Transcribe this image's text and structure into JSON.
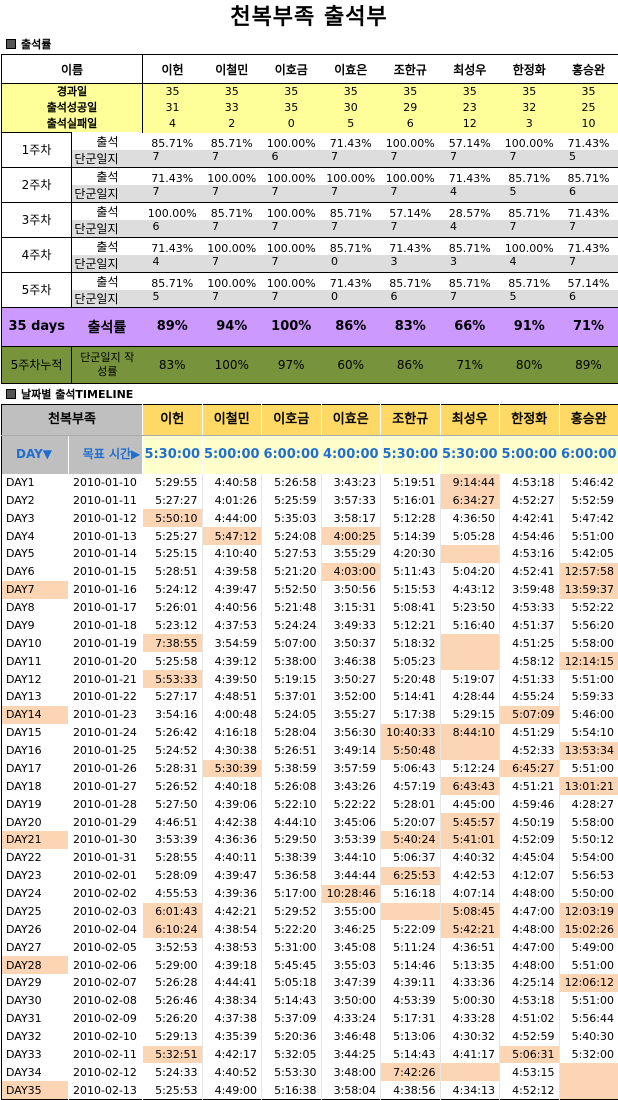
{
  "title": "천복부족 출석부",
  "section1_title": "출석률",
  "section2_title": "날짜별 출석TIMELINE",
  "members": [
    "이헌",
    "이철민",
    "이호금",
    "이효은",
    "조한규",
    "최성우",
    "한정화",
    "홍승완"
  ],
  "summary": {
    "name_label": "이름",
    "rows": [
      {
        "label": "경과일",
        "values": [
          "35",
          "35",
          "35",
          "35",
          "35",
          "35",
          "35",
          "35"
        ]
      },
      {
        "label": "출석성공일",
        "values": [
          "31",
          "33",
          "35",
          "30",
          "29",
          "23",
          "32",
          "25"
        ]
      },
      {
        "label": "출석실패일",
        "values": [
          "4",
          "2",
          "0",
          "5",
          "6",
          "12",
          "3",
          "10"
        ]
      }
    ]
  },
  "weeks": [
    {
      "label": "1주차",
      "att_label": "출석",
      "log_label": "단군일지",
      "att": [
        "85.71%",
        "85.71%",
        "100.00%",
        "71.43%",
        "100.00%",
        "57.14%",
        "100.00%",
        "71.43%"
      ],
      "log": [
        "7",
        "7",
        "6",
        "7",
        "7",
        "7",
        "7",
        "5"
      ]
    },
    {
      "label": "2주차",
      "att_label": "출석",
      "log_label": "단군일지",
      "att": [
        "71.43%",
        "100.00%",
        "100.00%",
        "100.00%",
        "100.00%",
        "71.43%",
        "85.71%",
        "85.71%"
      ],
      "log": [
        "7",
        "7",
        "7",
        "7",
        "7",
        "4",
        "5",
        "6"
      ]
    },
    {
      "label": "3주차",
      "att_label": "출석",
      "log_label": "단군일지",
      "att": [
        "100.00%",
        "85.71%",
        "100.00%",
        "85.71%",
        "57.14%",
        "28.57%",
        "85.71%",
        "71.43%"
      ],
      "log": [
        "6",
        "7",
        "7",
        "7",
        "7",
        "4",
        "7",
        "7"
      ]
    },
    {
      "label": "4주차",
      "att_label": "출석",
      "log_label": "단군일지",
      "att": [
        "71.43%",
        "100.00%",
        "100.00%",
        "85.71%",
        "71.43%",
        "85.71%",
        "100.00%",
        "71.43%"
      ],
      "log": [
        "4",
        "7",
        "7",
        "0",
        "3",
        "3",
        "4",
        "7"
      ]
    },
    {
      "label": "5주차",
      "att_label": "출석",
      "log_label": "단군일지",
      "att": [
        "85.71%",
        "100.00%",
        "100.00%",
        "71.43%",
        "85.71%",
        "85.71%",
        "85.71%",
        "57.14%"
      ],
      "log": [
        "5",
        "7",
        "7",
        "0",
        "6",
        "7",
        "5",
        "6"
      ]
    }
  ],
  "total": {
    "label": "35 days",
    "metric": "출석률",
    "values": [
      "89%",
      "94%",
      "100%",
      "86%",
      "83%",
      "66%",
      "91%",
      "71%"
    ]
  },
  "cumulative": {
    "label": "5주차누적",
    "metric": "단군일지 작성률",
    "values": [
      "83%",
      "100%",
      "97%",
      "60%",
      "86%",
      "71%",
      "80%",
      "89%"
    ]
  },
  "timeline": {
    "group_label": "천복부족",
    "day_header": "DAY▼",
    "target_header": "목표 시간▶",
    "targets": [
      "5:30:00",
      "5:00:00",
      "6:00:00",
      "4:00:00",
      "5:30:00",
      "5:30:00",
      "5:00:00",
      "6:00:00"
    ],
    "rows": [
      {
        "day": "DAY1",
        "date": "2010-01-10",
        "times": [
          "5:29:55",
          "4:40:58",
          "5:26:58",
          "3:43:23",
          "5:19:51",
          "9:14:44",
          "4:53:18",
          "5:46:42"
        ],
        "hl": [
          5
        ]
      },
      {
        "day": "DAY2",
        "date": "2010-01-11",
        "times": [
          "5:27:27",
          "4:01:26",
          "5:25:59",
          "3:57:33",
          "5:16:01",
          "6:34:27",
          "4:52:27",
          "5:52:59"
        ],
        "hl": [
          5
        ]
      },
      {
        "day": "DAY3",
        "date": "2010-01-12",
        "times": [
          "5:50:10",
          "4:44:00",
          "5:35:03",
          "3:58:17",
          "5:12:28",
          "4:36:50",
          "4:42:41",
          "5:47:42"
        ],
        "hl": [
          0
        ]
      },
      {
        "day": "DAY4",
        "date": "2010-01-13",
        "times": [
          "5:25:27",
          "5:47:12",
          "5:24:08",
          "4:00:25",
          "5:14:39",
          "5:05:28",
          "4:54:46",
          "5:51:00"
        ],
        "hl": [
          1,
          3
        ]
      },
      {
        "day": "DAY5",
        "date": "2010-01-14",
        "times": [
          "5:25:15",
          "4:10:40",
          "5:27:53",
          "3:55:29",
          "4:20:30",
          "",
          "4:53:16",
          "5:42:05"
        ],
        "hl": [
          5
        ]
      },
      {
        "day": "DAY6",
        "date": "2010-01-15",
        "times": [
          "5:28:51",
          "4:39:58",
          "5:21:20",
          "4:03:00",
          "5:11:43",
          "5:04:20",
          "4:52:41",
          "12:57:58"
        ],
        "hl": [
          3,
          7
        ]
      },
      {
        "day": "DAY7",
        "date": "2010-01-16",
        "times": [
          "5:24:12",
          "4:39:47",
          "5:52:50",
          "3:50:56",
          "5:15:53",
          "4:43:12",
          "3:59:48",
          "13:59:37"
        ],
        "hl": [
          7
        ],
        "dayhl": true
      },
      {
        "day": "DAY8",
        "date": "2010-01-17",
        "times": [
          "5:26:01",
          "4:40:56",
          "5:21:48",
          "3:15:31",
          "5:08:41",
          "5:23:50",
          "4:53:33",
          "5:52:22"
        ],
        "hl": []
      },
      {
        "day": "DAY9",
        "date": "2010-01-18",
        "times": [
          "5:23:12",
          "4:37:53",
          "5:24:24",
          "3:49:33",
          "5:12:21",
          "5:16:40",
          "4:51:37",
          "5:56:20"
        ],
        "hl": []
      },
      {
        "day": "DAY10",
        "date": "2010-01-19",
        "times": [
          "7:38:55",
          "3:54:59",
          "5:07:00",
          "3:50:37",
          "5:18:32",
          "",
          "4:51:25",
          "5:58:00"
        ],
        "hl": [
          0,
          5
        ]
      },
      {
        "day": "DAY11",
        "date": "2010-01-20",
        "times": [
          "5:25:58",
          "4:39:12",
          "5:38:00",
          "3:46:38",
          "5:05:23",
          "",
          "4:58:12",
          "12:14:15"
        ],
        "hl": [
          5,
          7
        ]
      },
      {
        "day": "DAY12",
        "date": "2010-01-21",
        "times": [
          "5:53:33",
          "4:39:50",
          "5:19:15",
          "3:50:27",
          "5:20:48",
          "5:19:07",
          "4:51:33",
          "5:51:00"
        ],
        "hl": [
          0
        ]
      },
      {
        "day": "DAY13",
        "date": "2010-01-22",
        "times": [
          "5:27:17",
          "4:48:51",
          "5:37:01",
          "3:52:00",
          "5:14:41",
          "4:28:44",
          "4:55:24",
          "5:59:33"
        ],
        "hl": []
      },
      {
        "day": "DAY14",
        "date": "2010-01-23",
        "times": [
          "3:54:16",
          "4:00:48",
          "5:24:05",
          "3:55:27",
          "5:17:38",
          "5:29:15",
          "5:07:09",
          "5:46:00"
        ],
        "hl": [
          6
        ],
        "dayhl": true
      },
      {
        "day": "DAY15",
        "date": "2010-01-24",
        "times": [
          "5:26:42",
          "4:16:18",
          "5:28:04",
          "3:56:30",
          "10:40:33",
          "8:44:10",
          "4:51:29",
          "5:54:10"
        ],
        "hl": [
          4,
          5
        ]
      },
      {
        "day": "DAY16",
        "date": "2010-01-25",
        "times": [
          "5:24:52",
          "4:30:38",
          "5:26:51",
          "3:49:14",
          "5:50:48",
          "",
          "4:52:33",
          "13:53:34"
        ],
        "hl": [
          4,
          5,
          7
        ]
      },
      {
        "day": "DAY17",
        "date": "2010-01-26",
        "times": [
          "5:28:31",
          "5:30:39",
          "5:38:59",
          "3:57:59",
          "5:06:43",
          "5:12:24",
          "6:45:27",
          "5:51:00"
        ],
        "hl": [
          1,
          6
        ]
      },
      {
        "day": "DAY18",
        "date": "2010-01-27",
        "times": [
          "5:26:52",
          "4:40:18",
          "5:26:08",
          "3:43:26",
          "4:57:19",
          "6:43:43",
          "4:51:21",
          "13:01:21"
        ],
        "hl": [
          5,
          7
        ]
      },
      {
        "day": "DAY19",
        "date": "2010-01-28",
        "times": [
          "5:27:50",
          "4:39:06",
          "5:22:10",
          "5:22:22",
          "5:28:01",
          "4:45:00",
          "4:59:46",
          "4:28:27"
        ],
        "hl": []
      },
      {
        "day": "DAY20",
        "date": "2010-01-29",
        "times": [
          "4:46:51",
          "4:42:38",
          "4:44:10",
          "3:45:06",
          "5:20:07",
          "5:45:57",
          "4:50:19",
          "5:58:00"
        ],
        "hl": [
          5
        ]
      },
      {
        "day": "DAY21",
        "date": "2010-01-30",
        "times": [
          "3:53:39",
          "4:36:36",
          "5:29:50",
          "3:53:39",
          "5:40:24",
          "5:41:01",
          "4:52:09",
          "5:50:12"
        ],
        "hl": [
          4,
          5
        ],
        "dayhl": true
      },
      {
        "day": "DAY22",
        "date": "2010-01-31",
        "times": [
          "5:28:55",
          "4:40:11",
          "5:38:39",
          "3:44:10",
          "5:06:37",
          "4:40:32",
          "4:45:04",
          "5:54:00"
        ],
        "hl": []
      },
      {
        "day": "DAY23",
        "date": "2010-02-01",
        "times": [
          "5:28:09",
          "4:39:47",
          "5:36:58",
          "3:44:44",
          "6:25:53",
          "4:42:53",
          "4:12:07",
          "5:56:53"
        ],
        "hl": [
          4
        ]
      },
      {
        "day": "DAY24",
        "date": "2010-02-02",
        "times": [
          "4:55:53",
          "4:39:36",
          "5:17:00",
          "10:28:46",
          "5:16:18",
          "4:07:14",
          "4:48:00",
          "5:50:00"
        ],
        "hl": [
          3
        ]
      },
      {
        "day": "DAY25",
        "date": "2010-02-03",
        "times": [
          "6:01:43",
          "4:42:21",
          "5:29:52",
          "3:55:00",
          "",
          "5:08:45",
          "4:47:00",
          "12:03:19"
        ],
        "hl": [
          0,
          4,
          5,
          7
        ]
      },
      {
        "day": "DAY26",
        "date": "2010-02-04",
        "times": [
          "6:10:24",
          "4:38:54",
          "5:22:20",
          "3:46:25",
          "5:22:09",
          "5:42:21",
          "4:48:00",
          "15:02:26"
        ],
        "hl": [
          0,
          5,
          7
        ]
      },
      {
        "day": "DAY27",
        "date": "2010-02-05",
        "times": [
          "3:52:53",
          "4:38:53",
          "5:31:00",
          "3:45:08",
          "5:11:24",
          "4:36:51",
          "4:47:00",
          "5:49:00"
        ],
        "hl": []
      },
      {
        "day": "DAY28",
        "date": "2010-02-06",
        "times": [
          "5:29:00",
          "4:39:18",
          "5:45:45",
          "3:55:03",
          "5:14:46",
          "5:13:35",
          "4:48:00",
          "5:51:00"
        ],
        "hl": [],
        "dayhl": true
      },
      {
        "day": "DAY29",
        "date": "2010-02-07",
        "times": [
          "5:26:28",
          "4:44:41",
          "5:05:18",
          "3:47:39",
          "4:39:11",
          "4:33:36",
          "4:25:14",
          "12:06:12"
        ],
        "hl": [
          7
        ]
      },
      {
        "day": "DAY30",
        "date": "2010-02-08",
        "times": [
          "5:26:46",
          "4:38:34",
          "5:14:43",
          "3:50:00",
          "4:53:39",
          "5:00:30",
          "4:53:18",
          "5:51:00"
        ],
        "hl": []
      },
      {
        "day": "DAY31",
        "date": "2010-02-09",
        "times": [
          "5:26:20",
          "4:37:38",
          "5:37:09",
          "4:33:24",
          "5:17:31",
          "4:33:28",
          "4:51:02",
          "5:56:44"
        ],
        "hl": []
      },
      {
        "day": "DAY32",
        "date": "2010-02-10",
        "times": [
          "5:29:13",
          "4:35:39",
          "5:20:36",
          "3:46:48",
          "5:13:06",
          "4:30:32",
          "4:52:59",
          "5:40:30"
        ],
        "hl": []
      },
      {
        "day": "DAY33",
        "date": "2010-02-11",
        "times": [
          "5:32:51",
          "4:42:17",
          "5:32:05",
          "3:44:25",
          "5:14:43",
          "4:41:17",
          "5:06:31",
          "5:32:00"
        ],
        "hl": [
          0,
          6
        ]
      },
      {
        "day": "DAY34",
        "date": "2010-02-12",
        "times": [
          "5:24:33",
          "4:40:52",
          "5:53:30",
          "3:48:00",
          "7:42:26",
          "",
          "4:53:15",
          ""
        ],
        "hl": [
          4,
          5,
          7
        ]
      },
      {
        "day": "DAY35",
        "date": "2010-02-13",
        "times": [
          "5:25:53",
          "4:49:00",
          "5:16:38",
          "3:58:04",
          "4:38:56",
          "4:34:13",
          "4:52:12",
          ""
        ],
        "hl": [
          7
        ],
        "dayhl": true
      }
    ]
  }
}
